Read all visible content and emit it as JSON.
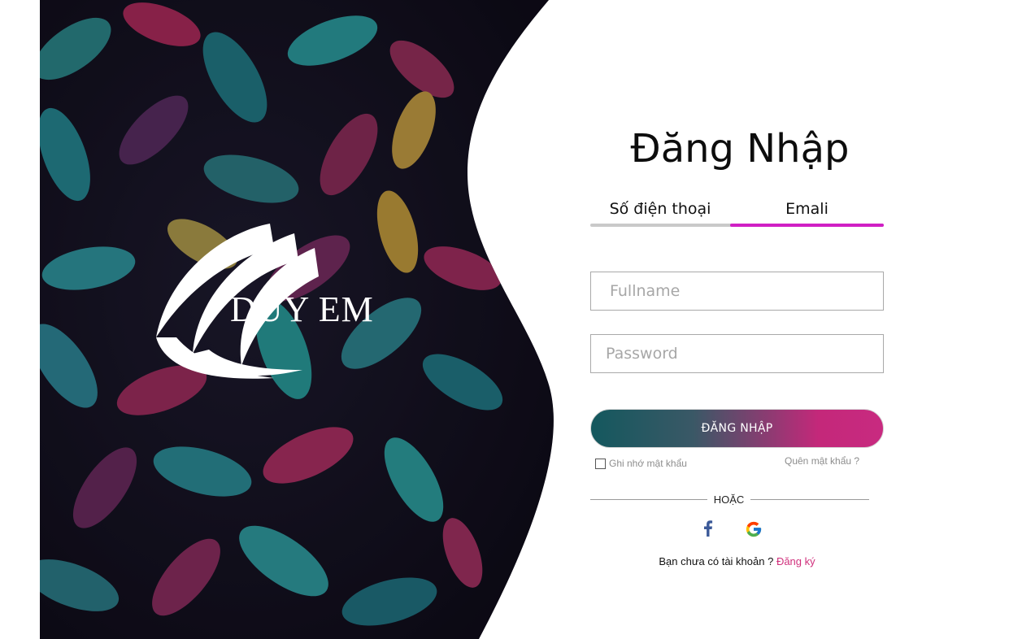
{
  "brand": {
    "logo_text": "DUY EM"
  },
  "login": {
    "title": "Đăng Nhập",
    "tabs": [
      {
        "label": "Số điện thoại",
        "active": false
      },
      {
        "label": "Emali",
        "active": true
      }
    ],
    "fullname_placeholder": "Fullname",
    "password_placeholder": "Password",
    "submit_label": "ĐĂNG NHẬP",
    "remember_label": "Ghi nhớ mật khẩu",
    "forgot_label": "Quên mật khẩu ?",
    "or_label": "HOẶC",
    "social": [
      {
        "icon": "facebook-icon"
      },
      {
        "icon": "google-icon"
      }
    ],
    "signup_prompt": "Bạn chưa có tài khoản ? ",
    "signup_link": "Đăng ký"
  },
  "colors": {
    "active_tab": "#d01fc4",
    "button_start": "#14585e",
    "button_end": "#c82a80",
    "link": "#d0307c",
    "facebook": "#3b5998"
  }
}
